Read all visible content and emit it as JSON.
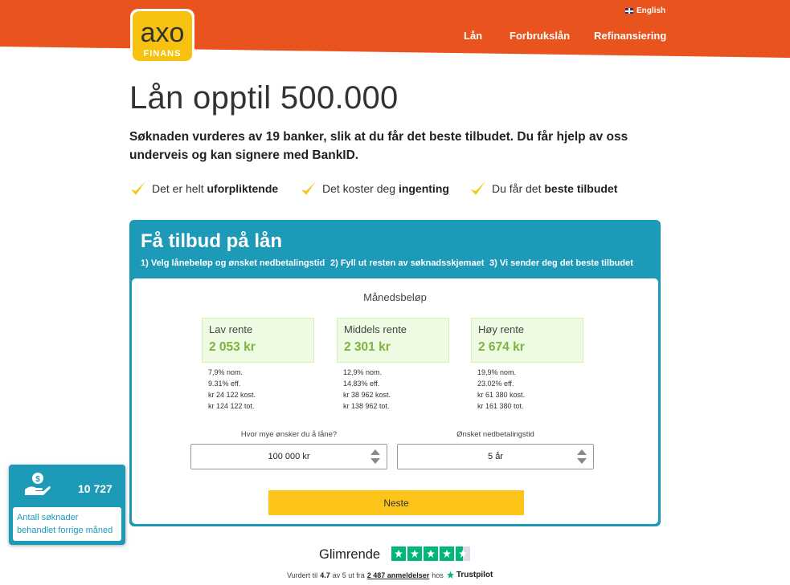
{
  "header": {
    "language": "English",
    "nav": [
      "Lån",
      "Forbrukslån",
      "Refinansiering"
    ],
    "logo": {
      "brand": "axo",
      "sub": "FINANS"
    }
  },
  "hero": {
    "title": "Lån opptil 500.000",
    "subtitle": "Søknaden vurderes av 19 banker, slik at du får det beste tilbudet. Du får hjelp av oss underveis og kan signere med BankID.",
    "usps": [
      {
        "pre": "Det er helt ",
        "bold": "uforpliktende"
      },
      {
        "pre": "Det koster deg ",
        "bold": "ingenting"
      },
      {
        "pre": "Du får det ",
        "bold": "beste tilbudet"
      }
    ]
  },
  "form": {
    "title": "Få tilbud på lån",
    "steps": [
      "1) Velg lånebeløp og ønsket nedbetalingstid",
      "2) Fyll ut resten av søknadsskjemaet",
      "3) Vi sender deg det beste tilbudet"
    ],
    "monthly_label": "Månedsbeløp",
    "rates": [
      {
        "name": "Lav rente",
        "amount": "2 053 kr",
        "nom": "7,9% nom.",
        "eff": "9.31% eff.",
        "cost": "kr 24 122 kost.",
        "total": "kr 124 122 tot."
      },
      {
        "name": "Middels rente",
        "amount": "2 301 kr",
        "nom": "12,9% nom.",
        "eff": "14.83% eff.",
        "cost": "kr 38 962 kost.",
        "total": "kr 138 962 tot."
      },
      {
        "name": "Høy rente",
        "amount": "2 674 kr",
        "nom": "19,9% nom.",
        "eff": "23.02% eff.",
        "cost": "kr 61 380 kost.",
        "total": "kr 161 380 tot."
      }
    ],
    "amount_label": "Hvor mye ønsker du å låne?",
    "amount_value": "100 000 kr",
    "term_label": "Ønsket nedbetalingstid",
    "term_value": "5 år",
    "next_button": "Neste"
  },
  "counter": {
    "number": "10 727",
    "text": "Antall søknader behandlet forrige måned"
  },
  "trustpilot": {
    "word": "Glimrende",
    "rated_prefix": "Vurdert til",
    "score": "4.7",
    "score_mid": "av 5 ut fra",
    "reviews": "2 487 anmeldelser",
    "at": "hos",
    "brand": "Trustpilot",
    "stars": 4.5
  },
  "colors": {
    "header": "#e8531e",
    "accent": "#1c9ab7",
    "button": "#fcc419",
    "check": "#f5c518",
    "rate_amount": "#7cb342",
    "trustpilot": "#00b67a"
  }
}
